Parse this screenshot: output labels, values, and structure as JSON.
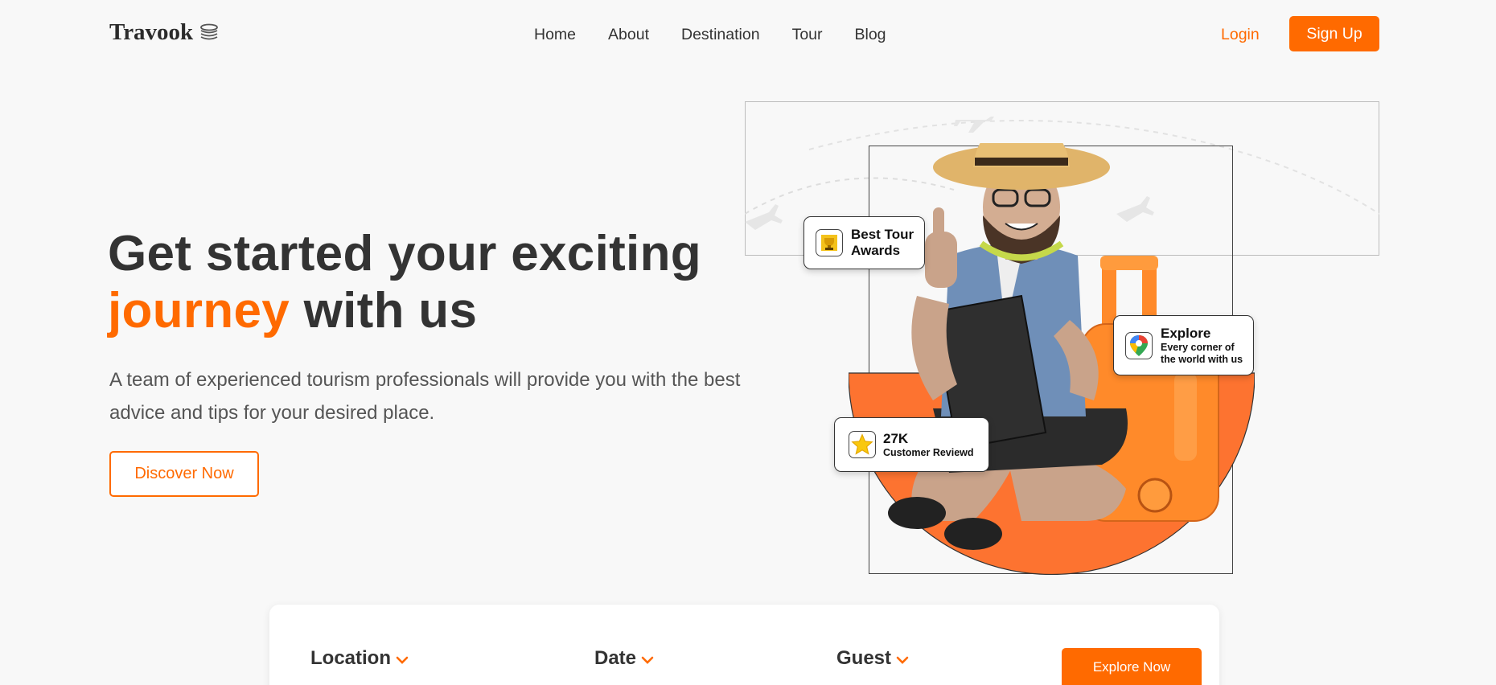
{
  "brand": {
    "name": "Travook"
  },
  "nav": {
    "items": [
      {
        "label": "Home"
      },
      {
        "label": "About"
      },
      {
        "label": "Destination"
      },
      {
        "label": "Tour"
      },
      {
        "label": "Blog"
      }
    ],
    "login_label": "Login",
    "signup_label": "Sign Up"
  },
  "hero": {
    "title_line1": "Get started your exciting",
    "title_accent": "journey",
    "title_rest": " with us",
    "description": "A team of experienced tourism professionals will provide you with the best advice and tips for your desired place.",
    "cta_label": "Discover Now"
  },
  "badges": {
    "award": {
      "line1": "Best Tour",
      "line2": "Awards",
      "icon": "trophy-icon"
    },
    "explore": {
      "title": "Explore",
      "line1": "Every corner of",
      "line2": "the world with us",
      "icon": "map-pin-icon"
    },
    "reviews": {
      "count": "27K",
      "label": "Customer Reviewd",
      "icon": "star-icon"
    }
  },
  "search": {
    "location_label": "Location",
    "date_label": "Date",
    "guest_label": "Guest",
    "explore_label": "Explore Now"
  },
  "colors": {
    "accent": "#ff6a00",
    "text": "#333333",
    "background": "#f8f8f8"
  }
}
